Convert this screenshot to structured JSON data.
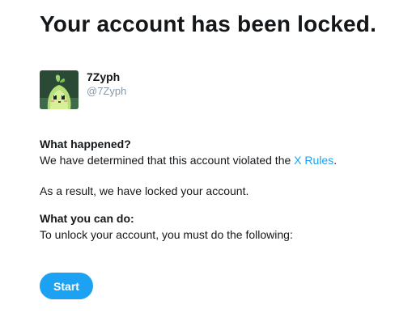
{
  "page": {
    "title": "Your account has been locked."
  },
  "account": {
    "display_name": "7Zyph",
    "handle": "@7Zyph",
    "avatar_icon": "green-leaf-character-avatar"
  },
  "content": {
    "what_happened_heading": "What happened?",
    "what_happened_text_before": "We have determined that this account violated the ",
    "rules_link_label": "X Rules",
    "what_happened_text_after": ".",
    "result_text": "As a result, we have locked your account.",
    "what_you_can_do_heading": "What you can do:",
    "what_you_can_do_text": "To unlock your account, you must do the following:"
  },
  "actions": {
    "start_label": "Start"
  },
  "colors": {
    "accent": "#1da1f2",
    "text": "#14171a",
    "muted": "#8899a6",
    "avatar_bg": "#2b4a36"
  }
}
